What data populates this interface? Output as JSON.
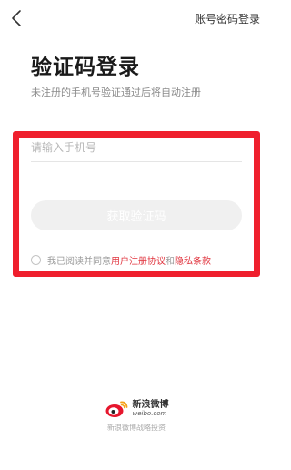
{
  "header": {
    "back_icon": "chevron-left-icon",
    "switch_label": "账号密码登录"
  },
  "main": {
    "title": "验证码登录",
    "subtitle": "未注册的手机号验证通过后将自动注册",
    "phone_placeholder": "请输入手机号",
    "phone_value": "",
    "code_button_label": "获取验证码"
  },
  "agreement": {
    "prefix": "我已阅读并同意",
    "user_agreement": "用户注册协议",
    "and": "和",
    "privacy_policy": "隐私条款"
  },
  "footer": {
    "brand_name": "新浪微博",
    "brand_domain": "weibo.com",
    "note": "新浪微博战略投资"
  },
  "colors": {
    "highlight_border": "#ef1f2d",
    "link": "#e0323c",
    "button_disabled": "#f0f0f0"
  }
}
